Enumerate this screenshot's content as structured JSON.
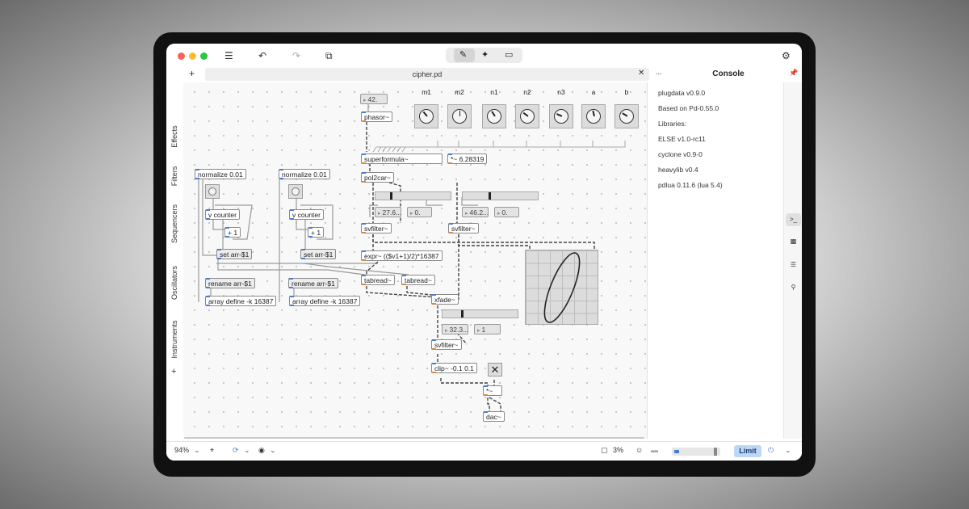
{
  "window": {
    "file_title": "cipher.pd",
    "console_title": "Console"
  },
  "toolbar": {
    "icons": [
      "menu-icon",
      "undo-icon",
      "redo-icon",
      "add-object-icon",
      "edit-mode-icon",
      "run-mode-icon",
      "presentation-mode-icon",
      "plugin-icon"
    ]
  },
  "sidebar_left": {
    "tabs": [
      "Effects",
      "Filters",
      "Sequencers",
      "Oscillators",
      "Instruments"
    ],
    "add_label": "+"
  },
  "console": {
    "lines": [
      "plugdata v0.9.0",
      "Based on Pd-0.55.0",
      "Libraries:",
      "ELSE v1.0-rc11",
      "cyclone v0.9-0",
      "heavylib v0.4",
      "pdlua 0.11.6 (lua 5.4)"
    ],
    "more_label": "...",
    "pin_icon": "pin-icon"
  },
  "patch": {
    "objects": {
      "normalize_1": "normalize 0.01",
      "normalize_2": "normalize 0.01",
      "counter_1": "v counter",
      "counter_2": "v counter",
      "plus_1": "+ 1",
      "plus_2": "+ 1",
      "setarr_1": "set arr-$1",
      "setarr_2": "set arr-$1",
      "rename_1": "rename arr-$1",
      "rename_2": "rename arr-$1",
      "arrdef_1": "array define -k 16387",
      "arrdef_2": "array define -k 16387",
      "phasor": "phasor~",
      "superformula": "superformula~",
      "times": "*~ 6.28319",
      "pol2car": "pol2car~",
      "svfilter_1": "svfilter~",
      "svfilter_2": "svfilter~",
      "svfilter_3": "svfilter~",
      "expr": "expr~ (($v1+1)/2)*16387",
      "tabread_1": "tabread~",
      "tabread_2": "tabread~",
      "xfade": "xfade~",
      "clip": "clip~ -0.1 0.1",
      "mult": "*~",
      "dac": "dac~"
    },
    "numbers": {
      "freq": "42.",
      "num_a1": "27.6...",
      "num_a2": "0.",
      "num_b1": "46.2...",
      "num_b2": "0.",
      "num_c1": "32.3...",
      "num_c2": "1"
    },
    "knobs": [
      {
        "label": "m1",
        "value": 0.35
      },
      {
        "label": "m2",
        "value": 0.5
      },
      {
        "label": "n1",
        "value": 0.38
      },
      {
        "label": "n2",
        "value": 0.3
      },
      {
        "label": "n3",
        "value": 0.25
      },
      {
        "label": "a",
        "value": 0.45
      },
      {
        "label": "b",
        "value": 0.28
      }
    ],
    "sliders": [
      {
        "name": "slider-a",
        "value": 0.2
      },
      {
        "name": "slider-b",
        "value": 0.36
      },
      {
        "name": "slider-c",
        "value": 0.26
      }
    ]
  },
  "statusbar": {
    "zoom": "94%",
    "cpu": "3%",
    "limit_label": "Limit"
  },
  "colors": {
    "accent": "#4a7ccf",
    "signal_wire": "#555555",
    "control_wire": "#9a9a9a",
    "limit_bg": "#bdd7f6"
  }
}
